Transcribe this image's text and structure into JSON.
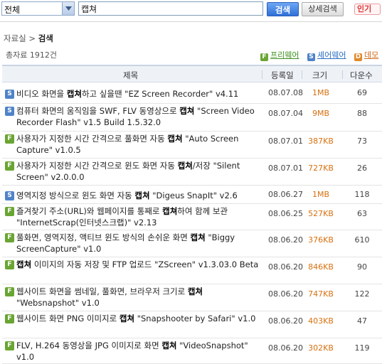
{
  "search": {
    "scope": "전체",
    "query": "캡쳐",
    "search_button": "검색",
    "detail_button": "상세검색",
    "popular_tag": "인기"
  },
  "breadcrumb": {
    "parent": "자료실 >",
    "current": "검색"
  },
  "total": "총자료 1912건",
  "filters": [
    {
      "badge": "F",
      "label": "프리웨어",
      "color": "#6aa533"
    },
    {
      "badge": "S",
      "label": "셰어웨어",
      "color": "#4f83c9"
    },
    {
      "badge": "D",
      "label": "데모",
      "color": "#e08a2a"
    }
  ],
  "columns": {
    "title": "제목",
    "date": "등록일",
    "size": "크기",
    "downloads": "다운수"
  },
  "rows": [
    {
      "badge": "S",
      "pre": "비디오 화면을 ",
      "kw": "캡쳐",
      "post": "하고 싶을땐 \"EZ Screen Recorder\" v4.11",
      "date": "08.07.08",
      "size": "1MB",
      "downloads": "69"
    },
    {
      "badge": "S",
      "pre": "컴퓨터 화면의 움직임을 SWF, FLV 동영상으로 ",
      "kw": "캡쳐",
      "post": " \"Screen Video Recorder Flash\" v1.5 Build 1.5.32.0",
      "date": "08.07.04",
      "size": "9MB",
      "downloads": "88"
    },
    {
      "badge": "F",
      "pre": "사용자가 지정한 시간 간격으로 풀화면 자동 ",
      "kw": "캡쳐",
      "post": " \"Auto Screen Capture\" v1.0.5",
      "date": "08.07.01",
      "size": "387KB",
      "downloads": "73"
    },
    {
      "badge": "F",
      "pre": "사용자가 지정한 시간 간격으로 윈도 화면 자동 ",
      "kw": "캡쳐",
      "post": "/저장 \"Silent Screen\" v2.0.0.0",
      "date": "08.07.01",
      "size": "727KB",
      "downloads": "26"
    },
    {
      "badge": "S",
      "pre": "영역지정 방식으로 윈도 화면 자동 ",
      "kw": "캡쳐",
      "post": " \"Digeus SnapIt\" v2.6",
      "date": "08.06.27",
      "size": "1MB",
      "downloads": "118"
    },
    {
      "badge": "F",
      "pre": "즐겨찾기 주소(URL)와 웹페이지를 통째로 ",
      "kw": "캡쳐",
      "post": "하여 함께 보관 \"InternetScrap(인터넷스크랩)\" v2.13",
      "date": "08.06.25",
      "size": "527KB",
      "downloads": "63"
    },
    {
      "badge": "F",
      "pre": "풀화면, 영역지정, 액티브 윈도 방식의 손쉬운 화면 ",
      "kw": "캡쳐",
      "post": " \"Biggy ScreenCapture\" v1.0",
      "date": "08.06.20",
      "size": "376KB",
      "downloads": "610"
    },
    {
      "badge": "F",
      "pre": "",
      "kw": "캡쳐",
      "post": " 이미지의 자동 저장 및 FTP 업로드 \"ZScreen\" v1.3.03.0 Beta",
      "date": "08.06.20",
      "size": "846KB",
      "downloads": "90"
    },
    {
      "badge": "F",
      "pre": "웹사이트 화면을 썸네일, 풀화면, 브라우저 크기로 ",
      "kw": "캡쳐",
      "post": " \"Websnapshot\" v1.0",
      "date": "08.06.20",
      "size": "747KB",
      "downloads": "122"
    },
    {
      "badge": "F",
      "pre": "웹사이트 화면 PNG 이미지로 ",
      "kw": "캡쳐",
      "post": " \"Snapshooter by Safari\" v1.0",
      "date": "08.06.20",
      "size": "403KB",
      "downloads": "47"
    },
    {
      "badge": "F",
      "pre": "FLV, H.264 동영상을 JPG 이미지로 화면 ",
      "kw": "캡쳐",
      "post": " \"VideoSnapshot\" v1.0",
      "date": "08.06.20",
      "size": "302KB",
      "downloads": "119"
    }
  ]
}
